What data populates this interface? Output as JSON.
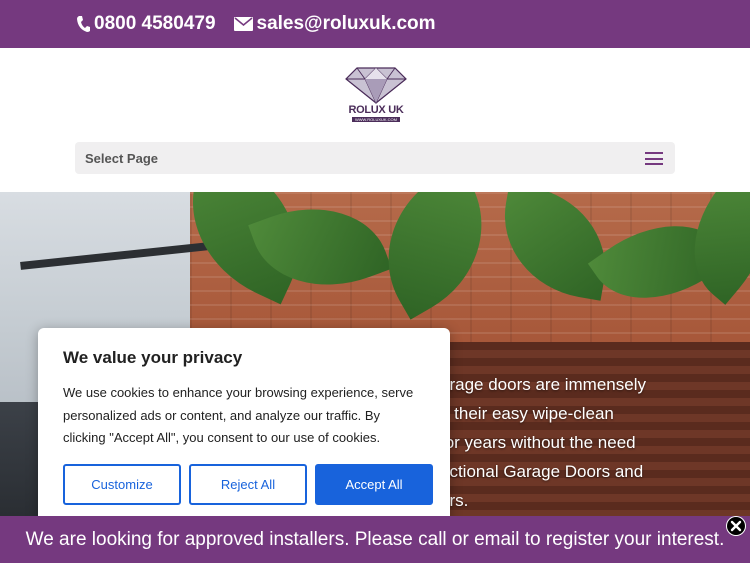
{
  "topbar": {
    "phone": "0800 4580479",
    "email": "sales@roluxuk.com",
    "phone_icon": "phone-icon",
    "email_icon": "envelope-icon"
  },
  "logo": {
    "name": "ROLUX UK",
    "url": "WWW.ROLUXUK.COM"
  },
  "nav": {
    "select_label": "Select Page",
    "menu_icon": "hamburger-icon"
  },
  "hero": {
    "lines": [
      "arage doors are immensely",
      "h their easy wipe-clean",
      "for years without the need",
      "ectional Garage Doors and",
      "ors."
    ]
  },
  "cookie": {
    "title": "We value your privacy",
    "body_lines": [
      "We use cookies to enhance your browsing experience, serve",
      "personalized ads or content, and analyze our traffic. By",
      "clicking \"Accept All\", you consent to our use of cookies."
    ],
    "customize_label": "Customize",
    "reject_label": "Reject All",
    "accept_label": "Accept All"
  },
  "banner": {
    "text": "We are looking for approved installers. Please call or email to register your interest.",
    "close_icon": "close-icon"
  },
  "colors": {
    "brand_purple": "#75397f",
    "cookie_blue": "#1863dc"
  }
}
